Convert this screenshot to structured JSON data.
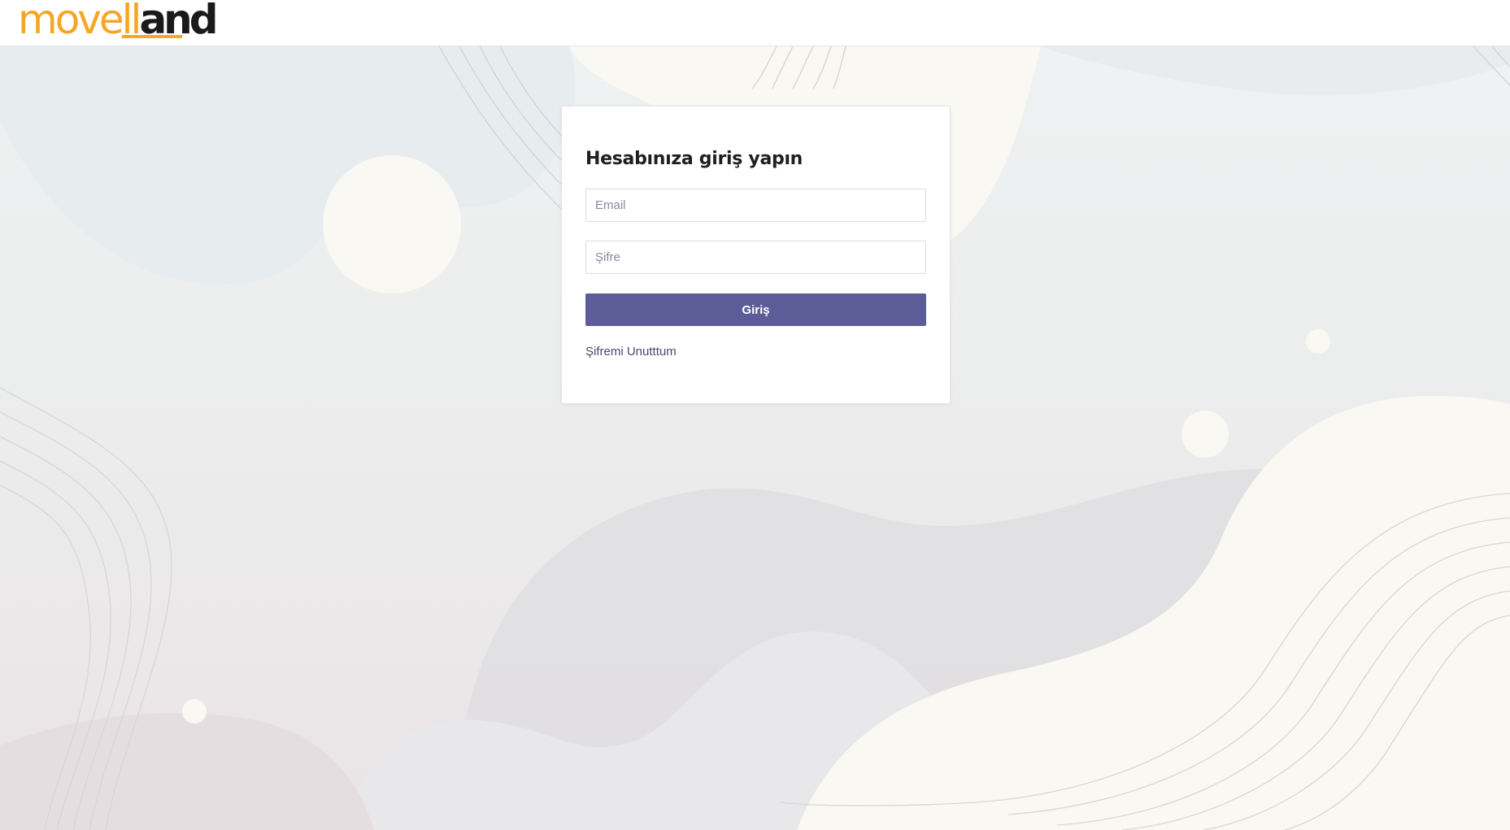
{
  "header": {
    "logo_part1": "movell",
    "logo_part2": "and"
  },
  "login": {
    "title": "Hesabınıza giriş yapın",
    "email_placeholder": "Email",
    "password_placeholder": "Şifre",
    "submit_label": "Giriş",
    "forgot_label": "Şifremi Unutttum"
  },
  "colors": {
    "logo_orange": "#f5a623",
    "button": "#5c5c99",
    "link": "#4a4870"
  }
}
